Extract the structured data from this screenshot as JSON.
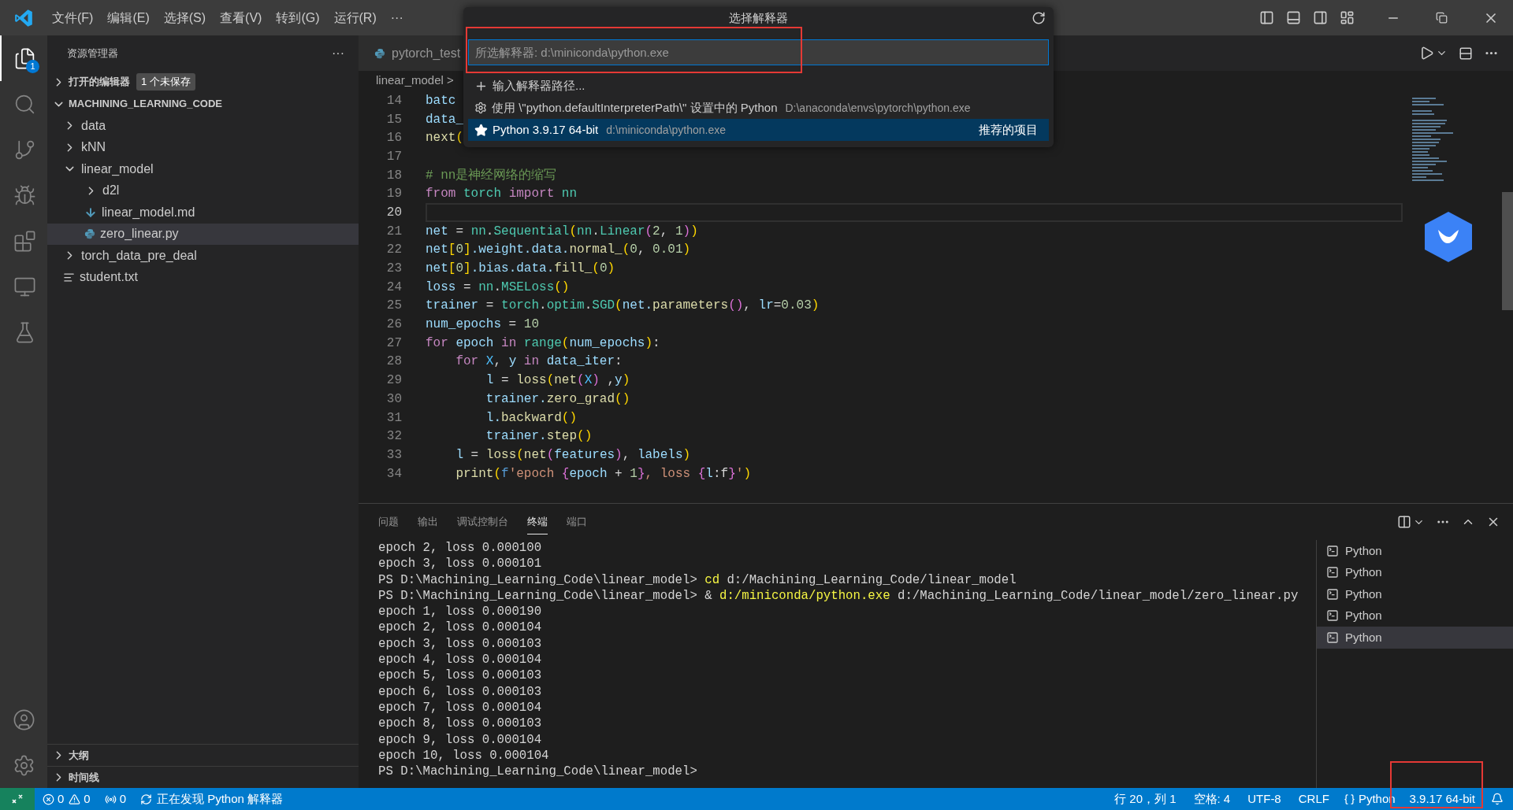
{
  "menu": [
    "文件(F)",
    "编辑(E)",
    "选择(S)",
    "查看(V)",
    "转到(G)",
    "运行(R)",
    "···"
  ],
  "activity": [
    {
      "kind": "explorer",
      "selected": true,
      "badge": "1"
    },
    {
      "kind": "search",
      "selected": false
    },
    {
      "kind": "git",
      "selected": false
    },
    {
      "kind": "debug",
      "selected": false
    },
    {
      "kind": "extensions",
      "selected": false
    },
    {
      "kind": "remote",
      "selected": false
    },
    {
      "kind": "testing",
      "selected": false
    }
  ],
  "activity_bottom": [
    {
      "kind": "account"
    },
    {
      "kind": "settings"
    }
  ],
  "sidebar": {
    "title": "资源管理器",
    "more": "···",
    "open_editors": {
      "label": "打开的编辑器",
      "badge": "1 个未保存"
    },
    "folder": "MACHINING_LEARNING_CODE",
    "items": [
      {
        "label": "data",
        "kind": "folder",
        "expanded": false,
        "selected": false
      },
      {
        "label": "kNN",
        "kind": "folder",
        "expanded": false,
        "selected": false
      },
      {
        "label": "linear_model",
        "kind": "folder",
        "expanded": true,
        "selected": false,
        "children": [
          {
            "label": "d2l",
            "kind": "folder",
            "expanded": false,
            "selected": false
          },
          {
            "label": "linear_model.md",
            "kind": "markdown",
            "selected": false
          },
          {
            "label": "zero_linear.py",
            "kind": "python",
            "selected": true
          }
        ]
      },
      {
        "label": "torch_data_pre_deal",
        "kind": "folder",
        "expanded": false,
        "selected": false
      },
      {
        "label": "student.txt",
        "kind": "text",
        "selected": false
      }
    ],
    "sections": [
      "大纲",
      "时间线"
    ]
  },
  "tab": {
    "label": "pytorch_test"
  },
  "breadcrumb": [
    "linear_model",
    ">"
  ],
  "code": [
    {
      "n": "14",
      "tokens": [
        {
          "text": "batc",
          "kind": "var"
        }
      ]
    },
    {
      "n": "15",
      "tokens": [
        {
          "text": "data_",
          "kind": "var"
        }
      ]
    },
    {
      "n": "16",
      "tokens": [
        {
          "text": "next",
          "kind": "func"
        },
        {
          "text": "(",
          "kind": "b1"
        }
      ]
    },
    {
      "n": "17"
    },
    {
      "n": "18",
      "tokens": [
        {
          "text": "# nn是神经网络的缩写",
          "kind": "comment"
        }
      ]
    },
    {
      "n": "19",
      "tokens": [
        {
          "text": "from",
          "kind": "kw"
        },
        {
          "text": " torch ",
          "kind": "class"
        },
        {
          "text": "import",
          "kind": "kw"
        },
        {
          "text": " nn",
          "kind": "class"
        }
      ]
    },
    {
      "n": "20",
      "current": true
    },
    {
      "n": "21",
      "tokens": [
        {
          "text": "net",
          "kind": "var"
        },
        {
          "text": " = ",
          "kind": "plain"
        },
        {
          "text": "nn",
          "kind": "class"
        },
        {
          "text": ".",
          "kind": "plain"
        },
        {
          "text": "Sequential",
          "kind": "class"
        },
        {
          "text": "(",
          "kind": "b1"
        },
        {
          "text": "nn",
          "kind": "class"
        },
        {
          "text": ".",
          "kind": "plain"
        },
        {
          "text": "Linear",
          "kind": "class"
        },
        {
          "text": "(",
          "kind": "b2"
        },
        {
          "text": "2",
          "kind": "num"
        },
        {
          "text": ", ",
          "kind": "plain"
        },
        {
          "text": "1",
          "kind": "num"
        },
        {
          "text": ")",
          "kind": "b2"
        },
        {
          "text": ")",
          "kind": "b1"
        }
      ]
    },
    {
      "n": "22",
      "tokens": [
        {
          "text": "net",
          "kind": "var"
        },
        {
          "text": "[",
          "kind": "b1"
        },
        {
          "text": "0",
          "kind": "num"
        },
        {
          "text": "]",
          "kind": "b1"
        },
        {
          "text": ".weight.data.",
          "kind": "var"
        },
        {
          "text": "normal_",
          "kind": "func"
        },
        {
          "text": "(",
          "kind": "b1"
        },
        {
          "text": "0",
          "kind": "num"
        },
        {
          "text": ", ",
          "kind": "plain"
        },
        {
          "text": "0.01",
          "kind": "num"
        },
        {
          "text": ")",
          "kind": "b1"
        }
      ]
    },
    {
      "n": "23",
      "tokens": [
        {
          "text": "net",
          "kind": "var"
        },
        {
          "text": "[",
          "kind": "b1"
        },
        {
          "text": "0",
          "kind": "num"
        },
        {
          "text": "]",
          "kind": "b1"
        },
        {
          "text": ".bias.data.",
          "kind": "var"
        },
        {
          "text": "fill_",
          "kind": "func"
        },
        {
          "text": "(",
          "kind": "b1"
        },
        {
          "text": "0",
          "kind": "num"
        },
        {
          "text": ")",
          "kind": "b1"
        }
      ]
    },
    {
      "n": "24",
      "tokens": [
        {
          "text": "loss",
          "kind": "var"
        },
        {
          "text": " = ",
          "kind": "plain"
        },
        {
          "text": "nn",
          "kind": "class"
        },
        {
          "text": ".",
          "kind": "plain"
        },
        {
          "text": "MSELoss",
          "kind": "class"
        },
        {
          "text": "()",
          "kind": "b1"
        }
      ]
    },
    {
      "n": "25",
      "tokens": [
        {
          "text": "trainer",
          "kind": "var"
        },
        {
          "text": " = ",
          "kind": "plain"
        },
        {
          "text": "torch",
          "kind": "class"
        },
        {
          "text": ".",
          "kind": "plain"
        },
        {
          "text": "optim",
          "kind": "class"
        },
        {
          "text": ".",
          "kind": "plain"
        },
        {
          "text": "SGD",
          "kind": "class"
        },
        {
          "text": "(",
          "kind": "b1"
        },
        {
          "text": "net.",
          "kind": "var"
        },
        {
          "text": "parameters",
          "kind": "func"
        },
        {
          "text": "()",
          "kind": "b2"
        },
        {
          "text": ", ",
          "kind": "plain"
        },
        {
          "text": "lr",
          "kind": "var"
        },
        {
          "text": "=",
          "kind": "plain"
        },
        {
          "text": "0.03",
          "kind": "num"
        },
        {
          "text": ")",
          "kind": "b1"
        }
      ]
    },
    {
      "n": "26",
      "tokens": [
        {
          "text": "num_epochs",
          "kind": "var"
        },
        {
          "text": " = ",
          "kind": "plain"
        },
        {
          "text": "10",
          "kind": "num"
        }
      ]
    },
    {
      "n": "27",
      "tokens": [
        {
          "text": "for",
          "kind": "kw"
        },
        {
          "text": " epoch ",
          "kind": "var"
        },
        {
          "text": "in",
          "kind": "kw"
        },
        {
          "text": " range",
          "kind": "class"
        },
        {
          "text": "(",
          "kind": "b1"
        },
        {
          "text": "num_epochs",
          "kind": "var"
        },
        {
          "text": ")",
          "kind": "b1"
        },
        {
          "text": ":",
          "kind": "plain"
        }
      ]
    },
    {
      "n": "28",
      "tokens": [
        {
          "text": "    for",
          "kind": "kw"
        },
        {
          "text": " X",
          "kind": "const"
        },
        {
          "text": ", ",
          "kind": "plain"
        },
        {
          "text": "y ",
          "kind": "var"
        },
        {
          "text": "in",
          "kind": "kw"
        },
        {
          "text": " data_iter",
          "kind": "var"
        },
        {
          "text": ":",
          "kind": "plain"
        }
      ]
    },
    {
      "n": "29",
      "tokens": [
        {
          "text": "        l",
          "kind": "var"
        },
        {
          "text": " = ",
          "kind": "plain"
        },
        {
          "text": "loss",
          "kind": "func"
        },
        {
          "text": "(",
          "kind": "b1"
        },
        {
          "text": "net",
          "kind": "func"
        },
        {
          "text": "(",
          "kind": "b2"
        },
        {
          "text": "X",
          "kind": "const"
        },
        {
          "text": ")",
          "kind": "b2"
        },
        {
          "text": " ,",
          "kind": "plain"
        },
        {
          "text": "y",
          "kind": "var"
        },
        {
          "text": ")",
          "kind": "b1"
        }
      ]
    },
    {
      "n": "30",
      "tokens": [
        {
          "text": "        trainer.",
          "kind": "var"
        },
        {
          "text": "zero_grad",
          "kind": "func"
        },
        {
          "text": "()",
          "kind": "b1"
        }
      ]
    },
    {
      "n": "31",
      "tokens": [
        {
          "text": "        l.",
          "kind": "var"
        },
        {
          "text": "backward",
          "kind": "func"
        },
        {
          "text": "()",
          "kind": "b1"
        }
      ]
    },
    {
      "n": "32",
      "tokens": [
        {
          "text": "        trainer.",
          "kind": "var"
        },
        {
          "text": "step",
          "kind": "func"
        },
        {
          "text": "()",
          "kind": "b1"
        }
      ]
    },
    {
      "n": "33",
      "tokens": [
        {
          "text": "    l",
          "kind": "var"
        },
        {
          "text": " = ",
          "kind": "plain"
        },
        {
          "text": "loss",
          "kind": "func"
        },
        {
          "text": "(",
          "kind": "b1"
        },
        {
          "text": "net",
          "kind": "func"
        },
        {
          "text": "(",
          "kind": "b2"
        },
        {
          "text": "features",
          "kind": "var"
        },
        {
          "text": ")",
          "kind": "b2"
        },
        {
          "text": ", ",
          "kind": "plain"
        },
        {
          "text": "labels",
          "kind": "var"
        },
        {
          "text": ")",
          "kind": "b1"
        }
      ]
    },
    {
      "n": "34",
      "tokens": [
        {
          "text": "    print",
          "kind": "func"
        },
        {
          "text": "(",
          "kind": "b1"
        },
        {
          "text": "f",
          "kind": "kw2"
        },
        {
          "text": "'epoch ",
          "kind": "str"
        },
        {
          "text": "{",
          "kind": "b2"
        },
        {
          "text": "epoch",
          "kind": "var"
        },
        {
          "text": " + ",
          "kind": "plain"
        },
        {
          "text": "1",
          "kind": "num"
        },
        {
          "text": "}",
          "kind": "b2"
        },
        {
          "text": ", loss ",
          "kind": "str"
        },
        {
          "text": "{",
          "kind": "b2"
        },
        {
          "text": "l",
          "kind": "var"
        },
        {
          "text": ":f",
          "kind": "plain"
        },
        {
          "text": "}",
          "kind": "b2"
        },
        {
          "text": "'",
          "kind": "str"
        },
        {
          "text": ")",
          "kind": "b1"
        }
      ]
    }
  ],
  "quick_pick": {
    "title": "选择解释器",
    "placeholder": "所选解释器: d:\\miniconda\\python.exe",
    "items": [
      {
        "kind": "add",
        "label": "输入解释器路径...",
        "selected": false
      },
      {
        "kind": "setting",
        "label": "使用 \\\"python.defaultInterpreterPath\\\" 设置中的 Python",
        "detail": "D:\\anaconda\\envs\\pytorch\\python.exe",
        "selected": false
      },
      {
        "kind": "star",
        "label": "Python 3.9.17 64-bit",
        "detail": "d:\\miniconda\\python.exe",
        "badge": "推荐的项目",
        "selected": true
      }
    ]
  },
  "panel": {
    "tabs": [
      {
        "label": "问题",
        "selected": false
      },
      {
        "label": "输出",
        "selected": false
      },
      {
        "label": "调试控制台",
        "selected": false
      },
      {
        "label": "终端",
        "selected": true
      },
      {
        "label": "端口",
        "selected": false
      }
    ],
    "terminal": [
      [
        {
          "text": "epoch 2, loss 0.000100",
          "kind": "plain"
        }
      ],
      [
        {
          "text": "epoch 3, loss 0.000101",
          "kind": "plain"
        }
      ],
      [
        {
          "text": "PS D:\\Machining_Learning_Code\\linear_model> ",
          "kind": "plain"
        },
        {
          "text": "cd",
          "kind": "cmd"
        },
        {
          "text": " d:/Machining_Learning_Code/linear_model",
          "kind": "plain"
        }
      ],
      [
        {
          "text": "PS D:\\Machining_Learning_Code\\linear_model> & ",
          "kind": "plain"
        },
        {
          "text": "d:/miniconda/python.exe",
          "kind": "cmd"
        },
        {
          "text": " d:/Machining_Learning_Code/linear_model/zero_linear.py",
          "kind": "plain"
        }
      ],
      [
        {
          "text": "epoch 1, loss 0.000190",
          "kind": "plain"
        }
      ],
      [
        {
          "text": "epoch 2, loss 0.000104",
          "kind": "plain"
        }
      ],
      [
        {
          "text": "epoch 3, loss 0.000103",
          "kind": "plain"
        }
      ],
      [
        {
          "text": "epoch 4, loss 0.000104",
          "kind": "plain"
        }
      ],
      [
        {
          "text": "epoch 5, loss 0.000103",
          "kind": "plain"
        }
      ],
      [
        {
          "text": "epoch 6, loss 0.000103",
          "kind": "plain"
        }
      ],
      [
        {
          "text": "epoch 7, loss 0.000104",
          "kind": "plain"
        }
      ],
      [
        {
          "text": "epoch 8, loss 0.000103",
          "kind": "plain"
        }
      ],
      [
        {
          "text": "epoch 9, loss 0.000104",
          "kind": "plain"
        }
      ],
      [
        {
          "text": "epoch 10, loss 0.000104",
          "kind": "plain"
        }
      ],
      [
        {
          "text": "PS D:\\Machining_Learning_Code\\linear_model>",
          "kind": "plain"
        }
      ]
    ],
    "terminals": [
      {
        "label": "Python",
        "selected": false
      },
      {
        "label": "Python",
        "selected": false
      },
      {
        "label": "Python",
        "selected": false
      },
      {
        "label": "Python",
        "selected": false
      },
      {
        "label": "Python",
        "selected": true
      }
    ]
  },
  "status": {
    "errors": "0",
    "warnings": "0",
    "ports": "0",
    "discovering": "正在发现 Python 解释器",
    "position": "行 20，列 1",
    "spaces": "空格: 4",
    "encoding": "UTF-8",
    "eol": "CRLF",
    "language": "Python",
    "interpreter": "3.9.17 64-bit"
  }
}
